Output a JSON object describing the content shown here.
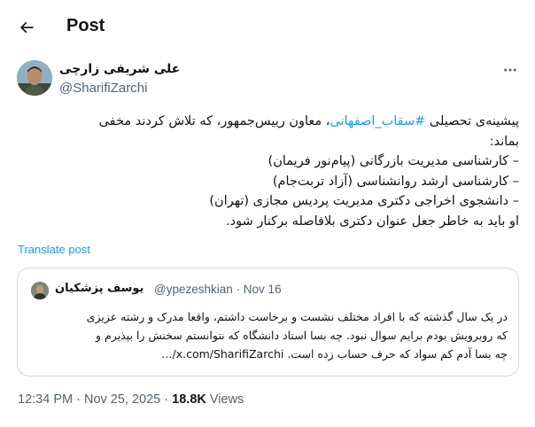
{
  "header": {
    "title": "Post"
  },
  "author": {
    "name": "علی شریفی زارچی",
    "handle": "@SharifiZarchi"
  },
  "tweet": {
    "line1_pre": "پیشینه‌ی تحصیلی ",
    "hashtag": "#سقاب_اصفهانی",
    "line1_post": "، معاون رییس‌جمهور، که تلاش کردند مخفی",
    "line2": "بماند:",
    "line3": "– کارشناسی مدیریت بازرگانی (پیام‌نور فریمان)",
    "line4": "– کارشناسی ارشد روانشناسی (آزاد تربت‌جام)",
    "line5": "– دانشجوی اخراجی دکتری مدیریت پردیس مجازی (تهران)",
    "line6": "او باید به خاطر جعل عنوان دکتری بلافاصله برکنار شود."
  },
  "translate_label": "Translate post",
  "quoted": {
    "name": "یوسف پزشکیان",
    "handle": "@ypezeshkian",
    "separator": "·",
    "date": "Nov 16",
    "line1": "در یک سال گذشته که با افراد مختلف نشست و برخاست داشتم، واقعا مدرک و رشته عزیزی",
    "line2": "که روبرویش بودم برایم سوال نبود. چه بسا استاد دانشگاه که نتوانستم سخنش را بپذیرم و",
    "line3": "چه بسا آدم کم سواد که حرف حساب زده است. x.com/SharifiZarchi/…"
  },
  "meta": {
    "time": "12:34 PM",
    "separator": "·",
    "date": "Nov 25, 2025",
    "separator2": "·",
    "views_count": "18.8K",
    "views_label": "Views"
  },
  "icons": {
    "back": "arrow-left-icon",
    "more": "more-horizontal-icon"
  },
  "colors": {
    "accent": "#1d9bf0",
    "secondary_text": "#536471",
    "border": "#cfd9de"
  }
}
